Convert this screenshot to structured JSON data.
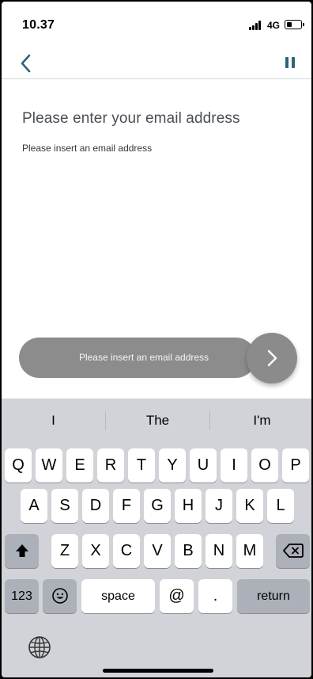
{
  "status_bar": {
    "time": "10.37",
    "network": "4G"
  },
  "nav": {
    "back_icon": "chevron-left-icon",
    "pause_icon": "pause-icon",
    "accent_color": "#2a6577"
  },
  "content": {
    "title": "Please enter your email address",
    "hint": "Please insert an email address"
  },
  "action_bar": {
    "label": "Please insert an email address",
    "next_icon": "chevron-right-icon",
    "color": "#8c8c8c"
  },
  "keyboard": {
    "suggestions": [
      "I",
      "The",
      "I'm"
    ],
    "row1": [
      "Q",
      "W",
      "E",
      "R",
      "T",
      "Y",
      "U",
      "I",
      "O",
      "P"
    ],
    "row2": [
      "A",
      "S",
      "D",
      "F",
      "G",
      "H",
      "J",
      "K",
      "L"
    ],
    "row3": [
      "Z",
      "X",
      "C",
      "V",
      "B",
      "N",
      "M"
    ],
    "numbers_label": "123",
    "space_label": "space",
    "at_label": "@",
    "dot_label": ".",
    "return_label": "return",
    "shift_icon": "shift-icon",
    "delete_icon": "delete-icon",
    "emoji_icon": "emoji-icon",
    "globe_icon": "globe-icon"
  }
}
